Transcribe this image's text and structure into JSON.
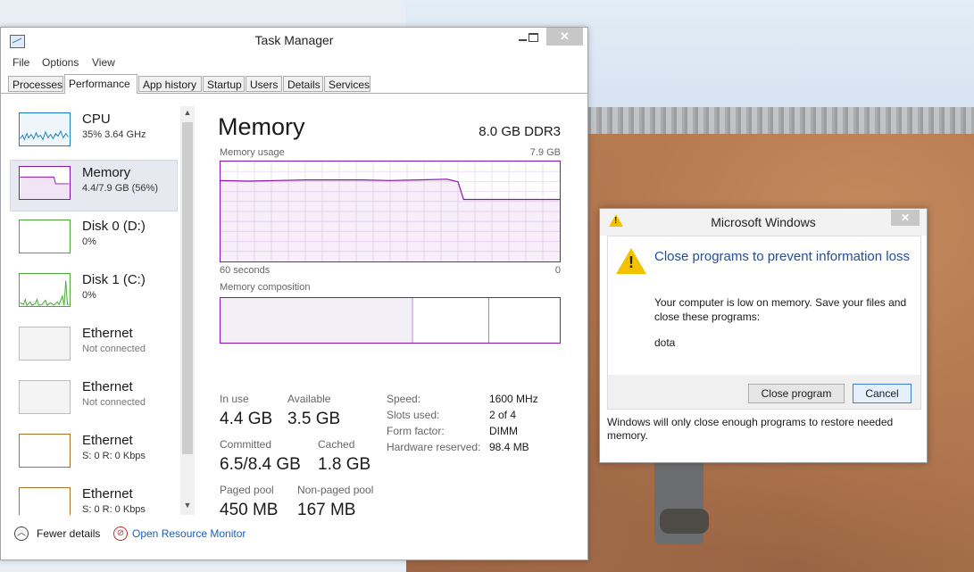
{
  "colors": {
    "memory_accent": "#8b12ae",
    "link": "#1f5fb5",
    "dialog_heading": "#1f4fa0",
    "cpu": "#1a7ec0",
    "disk": "#4da83a",
    "ethernet": "#a9742a"
  },
  "taskmanager": {
    "title": "Task Manager",
    "icon": "task-manager-icon",
    "menu": [
      "File",
      "Options",
      "View"
    ],
    "tabs": [
      "Processes",
      "Performance",
      "App history",
      "Startup",
      "Users",
      "Details",
      "Services"
    ],
    "active_tab": "Performance",
    "sidebar": [
      {
        "name": "CPU",
        "sub": "35%  3.64 GHz"
      },
      {
        "name": "Memory",
        "sub": "4.4/7.9 GB (56%)"
      },
      {
        "name": "Disk 0 (D:)",
        "sub": "0%"
      },
      {
        "name": "Disk 1 (C:)",
        "sub": "0%"
      },
      {
        "name": "Ethernet",
        "sub": "Not connected"
      },
      {
        "name": "Ethernet",
        "sub": "Not connected"
      },
      {
        "name": "Ethernet",
        "sub": "S: 0  R: 0 Kbps"
      },
      {
        "name": "Ethernet",
        "sub": "S: 0  R: 0 Kbps"
      }
    ],
    "main": {
      "title": "Memory",
      "spec": "8.0 GB DDR3",
      "usage_label": "Memory usage",
      "usage_max": "7.9 GB",
      "x_left": "60 seconds",
      "x_right": "0",
      "composition_label": "Memory composition",
      "stats": {
        "in_use_label": "In use",
        "in_use": "4.4 GB",
        "available_label": "Available",
        "available": "3.5 GB",
        "committed_label": "Committed",
        "committed": "6.5/8.4 GB",
        "cached_label": "Cached",
        "cached": "1.8 GB",
        "paged_label": "Paged pool",
        "paged": "450 MB",
        "nonpaged_label": "Non-paged pool",
        "nonpaged": "167 MB"
      },
      "details": [
        {
          "label": "Speed:",
          "value": "1600 MHz"
        },
        {
          "label": "Slots used:",
          "value": "2 of 4"
        },
        {
          "label": "Form factor:",
          "value": "DIMM"
        },
        {
          "label": "Hardware reserved:",
          "value": "98.4 MB"
        }
      ]
    },
    "fewer_details": "Fewer details",
    "open_resource_monitor": "Open Resource Monitor"
  },
  "chart_data": {
    "type": "area",
    "title": "Memory usage",
    "xlabel": "",
    "ylabel": "",
    "xlim": [
      60,
      0
    ],
    "ylim": [
      0,
      7.9
    ],
    "x": [
      60,
      55,
      50,
      45,
      40,
      35,
      30,
      25,
      20,
      18,
      17,
      15,
      10,
      5,
      0
    ],
    "series": [
      {
        "values": [
          6.4,
          6.35,
          6.4,
          6.45,
          6.45,
          6.45,
          6.4,
          6.45,
          6.5,
          6.3,
          4.9,
          4.9,
          4.9,
          4.9,
          4.9
        ]
      }
    ]
  },
  "dialog": {
    "title": "Microsoft Windows",
    "heading": "Close programs to prevent information loss",
    "message": "Your computer is low on memory. Save your files and close these programs:",
    "program": "dota",
    "close_program": "Close program",
    "cancel": "Cancel",
    "footer": "Windows will only close enough programs to restore needed memory."
  }
}
